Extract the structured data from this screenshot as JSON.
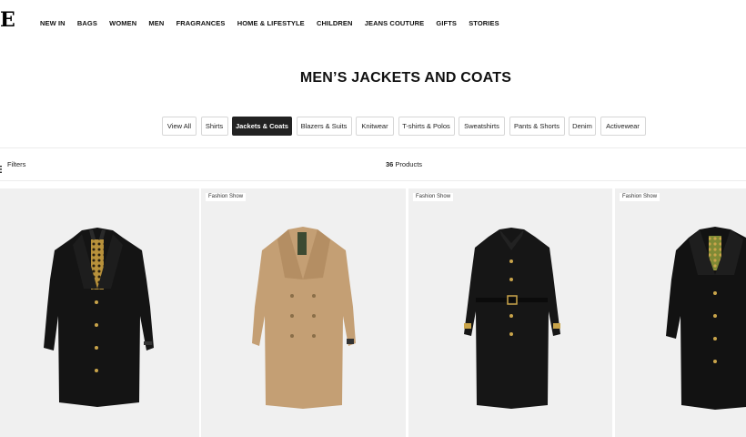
{
  "header": {
    "logo": "E",
    "nav": [
      "NEW IN",
      "BAGS",
      "WOMEN",
      "MEN",
      "FRAGRANCES",
      "HOME & LIFESTYLE",
      "CHILDREN",
      "JEANS COUTURE",
      "GIFTS",
      "STORIES"
    ]
  },
  "page": {
    "title": "MEN’S JACKETS AND COATS"
  },
  "tabs": {
    "items": [
      "View All",
      "Shirts",
      "Jackets & Coats",
      "Blazers & Suits",
      "Knitwear",
      "T-shirts & Polos",
      "Sweatshirts",
      "Pants & Shorts",
      "Denim",
      "Activewear"
    ],
    "active": "Jackets & Coats"
  },
  "filter_bar": {
    "filters_label": "Filters",
    "count_number": "36",
    "count_suffix": " Products"
  },
  "products": [
    {
      "badge": "",
      "color": "#141414",
      "trim": "#c9a44a"
    },
    {
      "badge": "Fashion Show",
      "color": "#c49f74",
      "trim": "#a9865d"
    },
    {
      "badge": "Fashion Show",
      "color": "#161616",
      "trim": "#c9a44a"
    },
    {
      "badge": "Fashion Show",
      "color": "#121212",
      "trim": "#c9a44a"
    }
  ]
}
